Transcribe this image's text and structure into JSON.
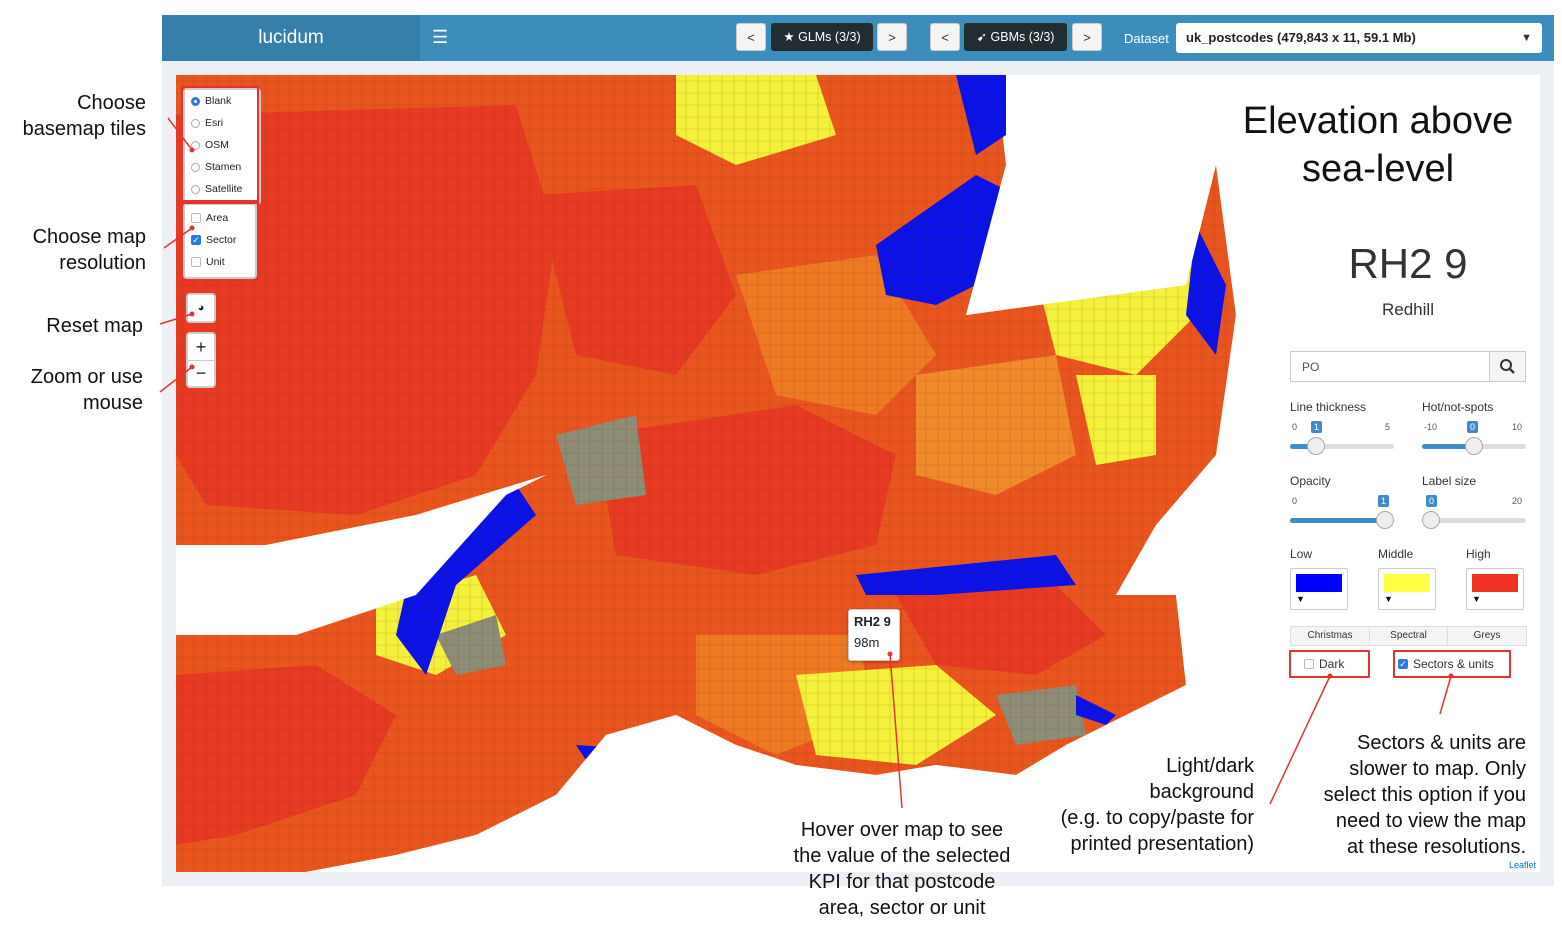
{
  "app": {
    "brand": "lucidum",
    "menu_icon": "hamburger-icon"
  },
  "navbar": {
    "prev": "<",
    "next": ">",
    "glms_label": "GLMs (3/3)",
    "glms_icon": "star-icon",
    "gbms_label": "GBMs (3/3)",
    "gbms_icon": "rocket-icon",
    "dataset_label": "Dataset",
    "dataset_value": "uk_postcodes (479,843 x 11, 59.1 Mb)"
  },
  "map": {
    "basemaps": [
      {
        "label": "Blank",
        "selected": true
      },
      {
        "label": "Esri",
        "selected": false
      },
      {
        "label": "OSM",
        "selected": false
      },
      {
        "label": "Stamen",
        "selected": false
      },
      {
        "label": "Satellite",
        "selected": false
      }
    ],
    "resolutions": [
      {
        "label": "Area",
        "checked": false
      },
      {
        "label": "Sector",
        "checked": true
      },
      {
        "label": "Unit",
        "checked": false
      }
    ],
    "reset_icon": "globe-icon",
    "zoom_in": "+",
    "zoom_out": "−",
    "tooltip": {
      "code": "RH2 9",
      "value": "98m"
    },
    "attribution": "Leaflet",
    "colors": {
      "low": "#0a12e8",
      "mid": "#f4f13b",
      "high": "#e63b22",
      "grey": "#8d8d75",
      "orange": "#ee7a24"
    }
  },
  "panel": {
    "title_line1": "Elevation above",
    "title_line2": "sea-level",
    "postcode": "RH2 9",
    "postcode_name": "Redhill",
    "search_value": "PO",
    "search_icon": "search-icon",
    "sliders": {
      "line_thickness": {
        "label": "Line thickness",
        "min": "0",
        "max": "5",
        "value": "1",
        "fraction": 0.2
      },
      "hot_spots": {
        "label": "Hot/not-spots",
        "min": "-10",
        "max": "10",
        "value": "0",
        "fraction": 0.5
      },
      "opacity": {
        "label": "Opacity",
        "min": "0",
        "max": "1",
        "value": "1",
        "fraction": 1.0
      },
      "label_size": {
        "label": "Label size",
        "min": "0",
        "max": "20",
        "value": "0",
        "fraction": 0.0
      }
    },
    "colors": [
      {
        "label": "Low",
        "hex": "#0000ff"
      },
      {
        "label": "Middle",
        "hex": "#ffff44"
      },
      {
        "label": "High",
        "hex": "#ee3322"
      }
    ],
    "palettes": [
      "Christmas",
      "Spectral",
      "Greys"
    ],
    "dark": {
      "label": "Dark",
      "checked": false
    },
    "sectors_units": {
      "label": "Sectors & units",
      "checked": true
    }
  },
  "annotations": {
    "basemap": [
      "Choose",
      "basemap tiles"
    ],
    "resolution": [
      "Choose map",
      "resolution"
    ],
    "reset": [
      "Reset map"
    ],
    "zoom": [
      "Zoom or use",
      "mouse"
    ],
    "hover": [
      "Hover over map to see",
      "the value of the selected",
      "KPI for that postcode",
      "area, sector or unit"
    ],
    "background": [
      "Light/dark",
      "background",
      "(e.g. to copy/paste for",
      "printed presentation)"
    ],
    "sectors": [
      "Sectors & units are",
      "slower to map.  Only",
      "select this option if you",
      "need to view the map",
      "at these resolutions."
    ]
  }
}
